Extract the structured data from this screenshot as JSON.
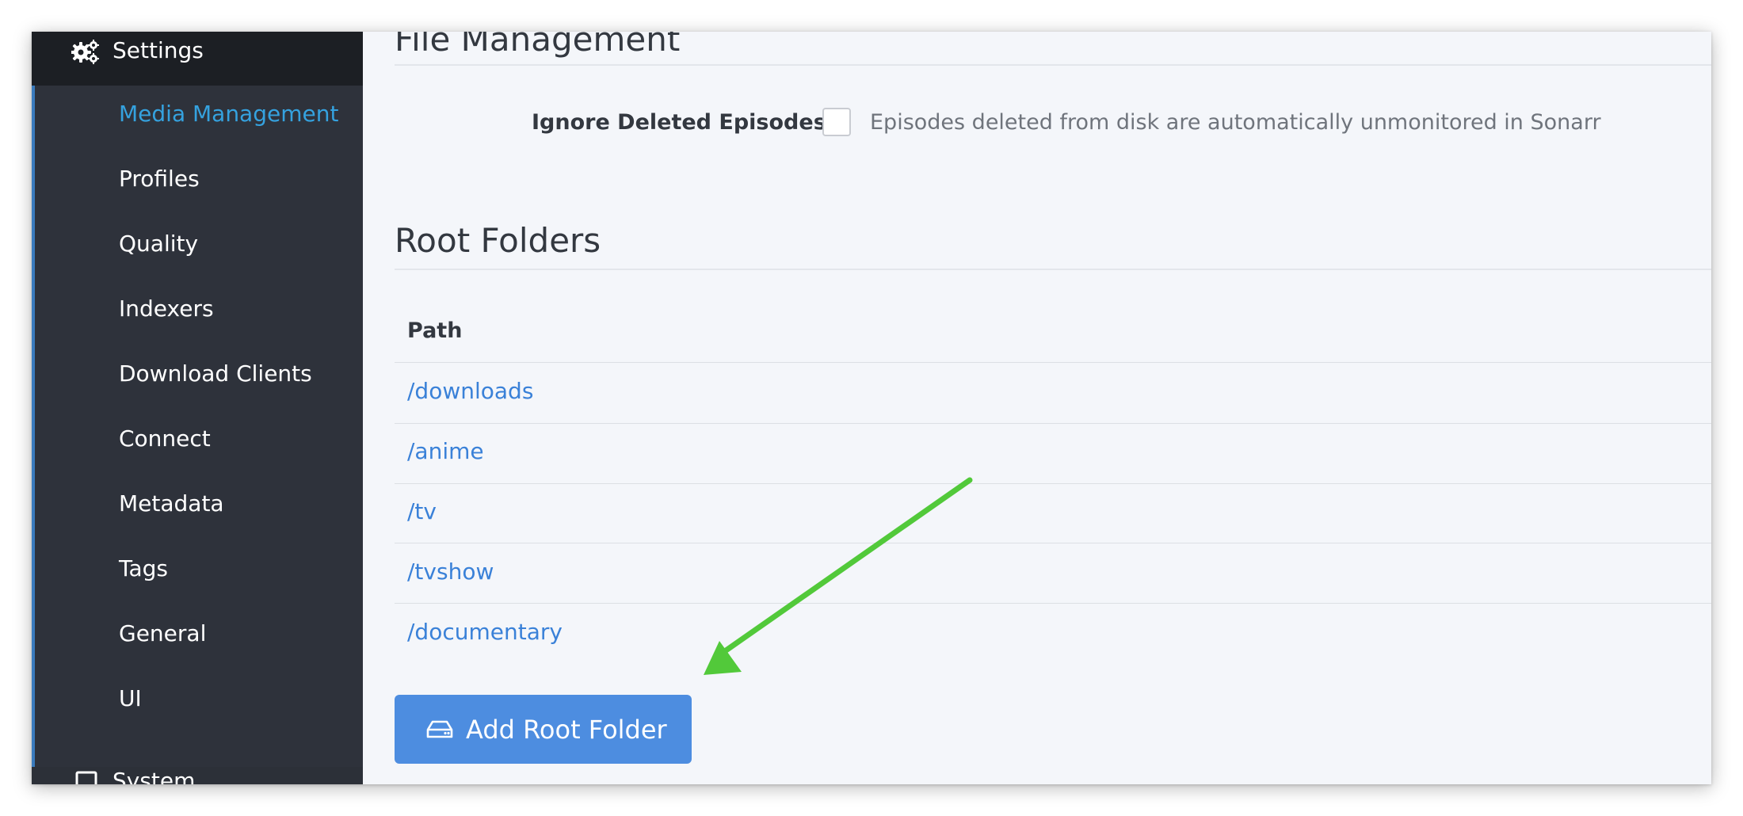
{
  "sidebar": {
    "settings_label": "Settings",
    "settings_icon": "gears-icon",
    "items": [
      {
        "label": "Media Management",
        "active": true
      },
      {
        "label": "Profiles",
        "active": false
      },
      {
        "label": "Quality",
        "active": false
      },
      {
        "label": "Indexers",
        "active": false
      },
      {
        "label": "Download Clients",
        "active": false
      },
      {
        "label": "Connect",
        "active": false
      },
      {
        "label": "Metadata",
        "active": false
      },
      {
        "label": "Tags",
        "active": false
      },
      {
        "label": "General",
        "active": false
      },
      {
        "label": "UI",
        "active": false
      }
    ],
    "system_label": "System",
    "system_icon": "laptop-icon"
  },
  "file_management": {
    "title": "File Management",
    "ignore_deleted_label": "Ignore Deleted Episodes",
    "ignore_deleted_checked": false,
    "ignore_deleted_help": "Episodes deleted from disk are automatically unmonitored in Sonarr"
  },
  "root_folders": {
    "title": "Root Folders",
    "column_header": "Path",
    "paths": [
      "/downloads",
      "/anime",
      "/tv",
      "/tvshow",
      "/documentary"
    ],
    "add_button_label": "Add Root Folder",
    "add_button_icon": "hard-drive-icon"
  },
  "colors": {
    "sidebar_bg": "#2c3038",
    "active_link": "#35a2df",
    "path_link": "#3a81d8",
    "primary_button": "#4d8de0",
    "annotation_arrow": "#52c93a"
  }
}
